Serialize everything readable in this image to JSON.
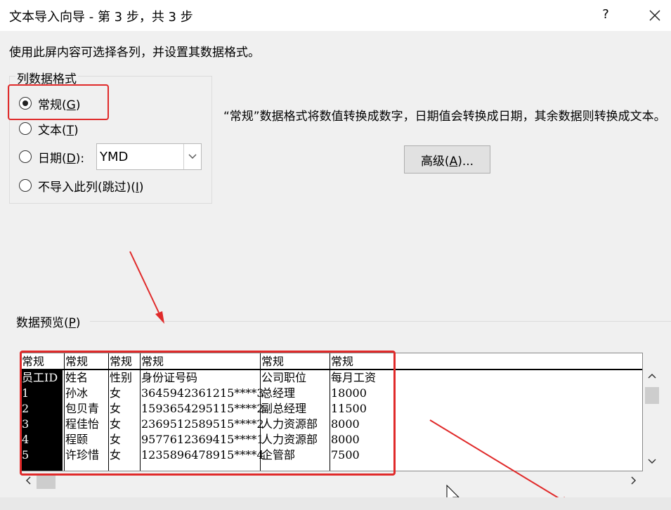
{
  "window": {
    "title": "文本导入向导 - 第 3 步，共 3 步",
    "help_glyph": "?"
  },
  "instruction": "使用此屏内容可选择各列，并设置其数据格式。",
  "column_format": {
    "group_label": "列数据格式",
    "general_pre": "常规(",
    "general_key": "G",
    "general_post": ")",
    "text_pre": "文本(",
    "text_key": "T",
    "text_post": ")",
    "date_pre": "日期(",
    "date_key": "D",
    "date_post": "):",
    "skip_pre": "不导入此列(跳过)(",
    "skip_key": "I",
    "skip_post": ")",
    "selected": "general",
    "date_value": "YMD"
  },
  "description": "“常规”数据格式将数值转换成数字，日期值会转换成日期，其余数据则转换成文本。",
  "advanced": {
    "pre": "高级(",
    "key": "A",
    "post": ")..."
  },
  "preview": {
    "label_pre": "数据预览(",
    "label_key": "P",
    "label_post": ")",
    "headers": [
      "常规",
      "常规",
      "常规",
      "常规",
      "常规",
      "常规"
    ],
    "rows": [
      [
        "员工ID",
        "姓名",
        "性别",
        "身份证号码",
        "公司职位",
        "每月工资"
      ],
      [
        "1",
        "孙冰",
        "女",
        "3645942361215****3",
        "总经理",
        "18000"
      ],
      [
        "2",
        "包贝青",
        "女",
        "1593654295115****2",
        "副总经理",
        "11500"
      ],
      [
        "3",
        "程佳怡",
        "女",
        "2369512589515****2",
        "人力资源部",
        "8000"
      ],
      [
        "4",
        "程颐",
        "女",
        "9577612369415****1",
        "人力资源部",
        "8000"
      ],
      [
        "5",
        "许珍惜",
        "女",
        "1235896478915****4",
        "企管部",
        "7500"
      ]
    ]
  },
  "colors": {
    "annotation_red": "#e02a2a",
    "selected_column_bg": "#000000"
  }
}
